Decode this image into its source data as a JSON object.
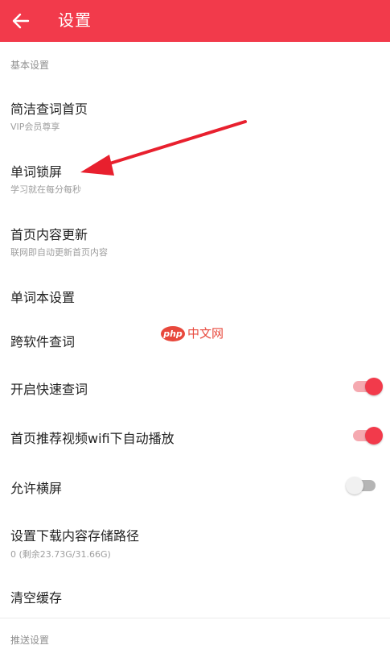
{
  "header": {
    "title": "设置",
    "back_icon": "arrow-left-icon",
    "bg_color": "#f23a4b"
  },
  "sections": {
    "basic": "基本设置",
    "push": "推送设置"
  },
  "items": {
    "simple_home": {
      "label": "简洁查词首页",
      "sub": "VIP会员尊享"
    },
    "word_lock": {
      "label": "单词锁屏",
      "sub": "学习就在每分每秒"
    },
    "home_update": {
      "label": "首页内容更新",
      "sub": "联网即自动更新首页内容"
    },
    "wordbook": {
      "label": "单词本设置"
    },
    "cross_app": {
      "label": "跨软件查词"
    },
    "quick_lookup": {
      "label": "开启快速查词",
      "enabled": true
    },
    "autoplay": {
      "label": "首页推荐视频wifi下自动播放",
      "enabled": true
    },
    "landscape": {
      "label": "允许横屏",
      "enabled": false
    },
    "download_path": {
      "label": "设置下载内容存储路径",
      "sub": "0 (剩余23.73G/31.66G)"
    },
    "clear_cache": {
      "label": "清空缓存"
    }
  },
  "watermark": {
    "logo": "php",
    "text": "中文网"
  },
  "annotation": {
    "color": "#e8202e"
  }
}
